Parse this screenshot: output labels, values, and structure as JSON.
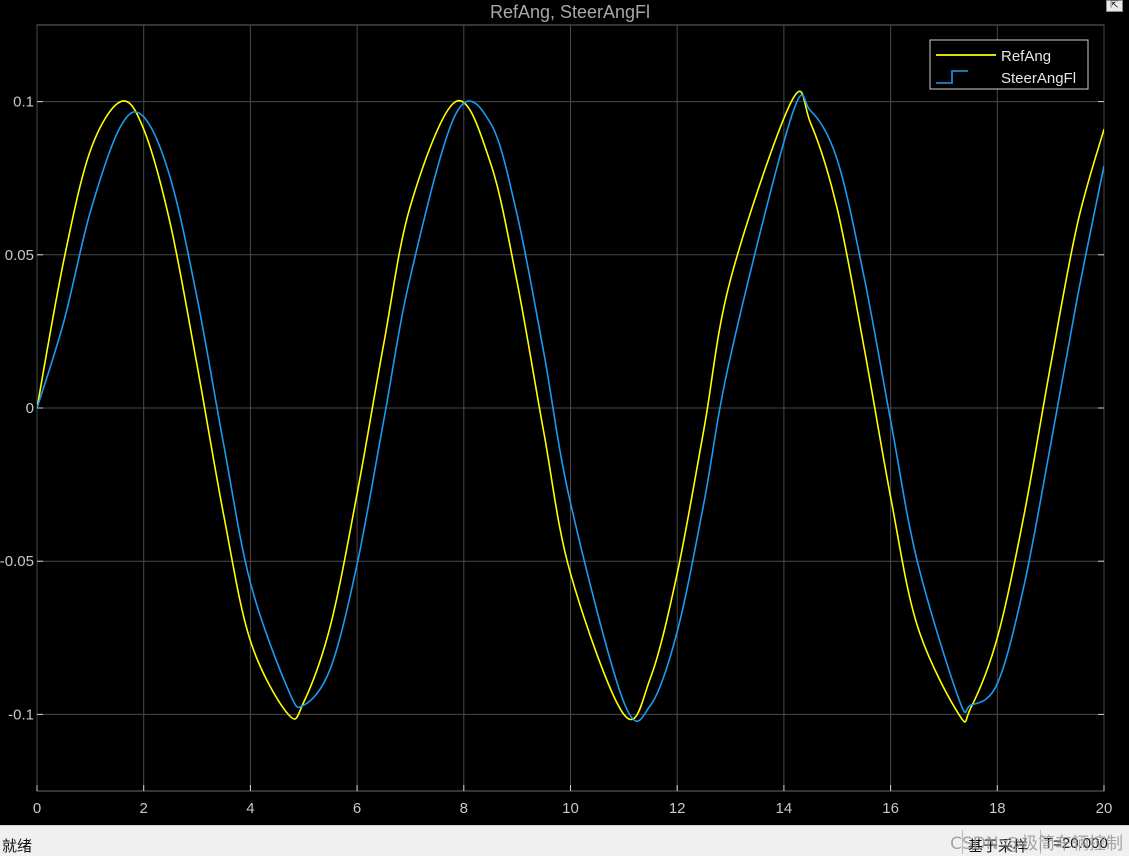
{
  "window": {
    "title": "RefAng, SteerAngFl"
  },
  "chart_data": {
    "type": "line",
    "title": "RefAng, SteerAngFl",
    "xlabel": "",
    "ylabel": "",
    "xlim": [
      0,
      20
    ],
    "ylim": [
      -0.125,
      0.125
    ],
    "xticks": [
      0,
      2,
      4,
      6,
      8,
      10,
      12,
      14,
      16,
      18,
      20
    ],
    "yticks": [
      -0.1,
      -0.05,
      0,
      0.05,
      0.1
    ],
    "xtick_labels": [
      "0",
      "2",
      "4",
      "6",
      "8",
      "10",
      "12",
      "14",
      "16",
      "18",
      "20"
    ],
    "ytick_labels": [
      "-0.1",
      "-0.05",
      "0",
      "0.05",
      "0.1"
    ],
    "grid": true,
    "legend": "top-right",
    "x": [
      0,
      0.5,
      1.0,
      1.57,
      2.0,
      2.5,
      3.0,
      3.5,
      4.0,
      4.71,
      5.0,
      5.5,
      6.0,
      6.5,
      7.0,
      7.85,
      8.5,
      9.0,
      9.5,
      10.0,
      11.0,
      11.5,
      12.0,
      12.5,
      13.0,
      14.14,
      14.5,
      15.0,
      15.5,
      16.0,
      16.5,
      17.28,
      17.5,
      18.0,
      18.5,
      19.0,
      19.5,
      20.0
    ],
    "series": [
      {
        "name": "RefAng",
        "color": "#ffff00",
        "style": "line",
        "values": [
          0.0,
          0.048,
          0.084,
          0.1,
          0.091,
          0.06,
          0.014,
          -0.035,
          -0.076,
          -0.1,
          -0.096,
          -0.071,
          -0.028,
          0.021,
          0.066,
          0.1,
          0.08,
          0.041,
          -0.008,
          -0.054,
          -0.1,
          -0.088,
          -0.054,
          -0.007,
          0.042,
          0.1,
          0.093,
          0.065,
          0.02,
          -0.029,
          -0.071,
          -0.1,
          -0.098,
          -0.075,
          -0.035,
          0.014,
          0.06,
          0.091
        ]
      },
      {
        "name": "SteerAngFl",
        "color": "#1a9bf2",
        "style": "step",
        "values": [
          0.0,
          0.028,
          0.064,
          0.092,
          0.095,
          0.075,
          0.036,
          -0.012,
          -0.057,
          -0.092,
          -0.097,
          -0.085,
          -0.051,
          -0.004,
          0.043,
          0.096,
          0.093,
          0.063,
          0.018,
          -0.031,
          -0.096,
          -0.097,
          -0.073,
          -0.031,
          0.017,
          0.095,
          0.097,
          0.081,
          0.043,
          -0.004,
          -0.05,
          -0.095,
          -0.097,
          -0.09,
          -0.058,
          -0.012,
          0.036,
          0.079
        ]
      }
    ]
  },
  "statusbar": {
    "ready": "就绪",
    "sample": "基于采样",
    "time": "T=20.000"
  },
  "watermark": "CSDN @极简车辆控制",
  "icons": {
    "undock": "undock-icon"
  }
}
